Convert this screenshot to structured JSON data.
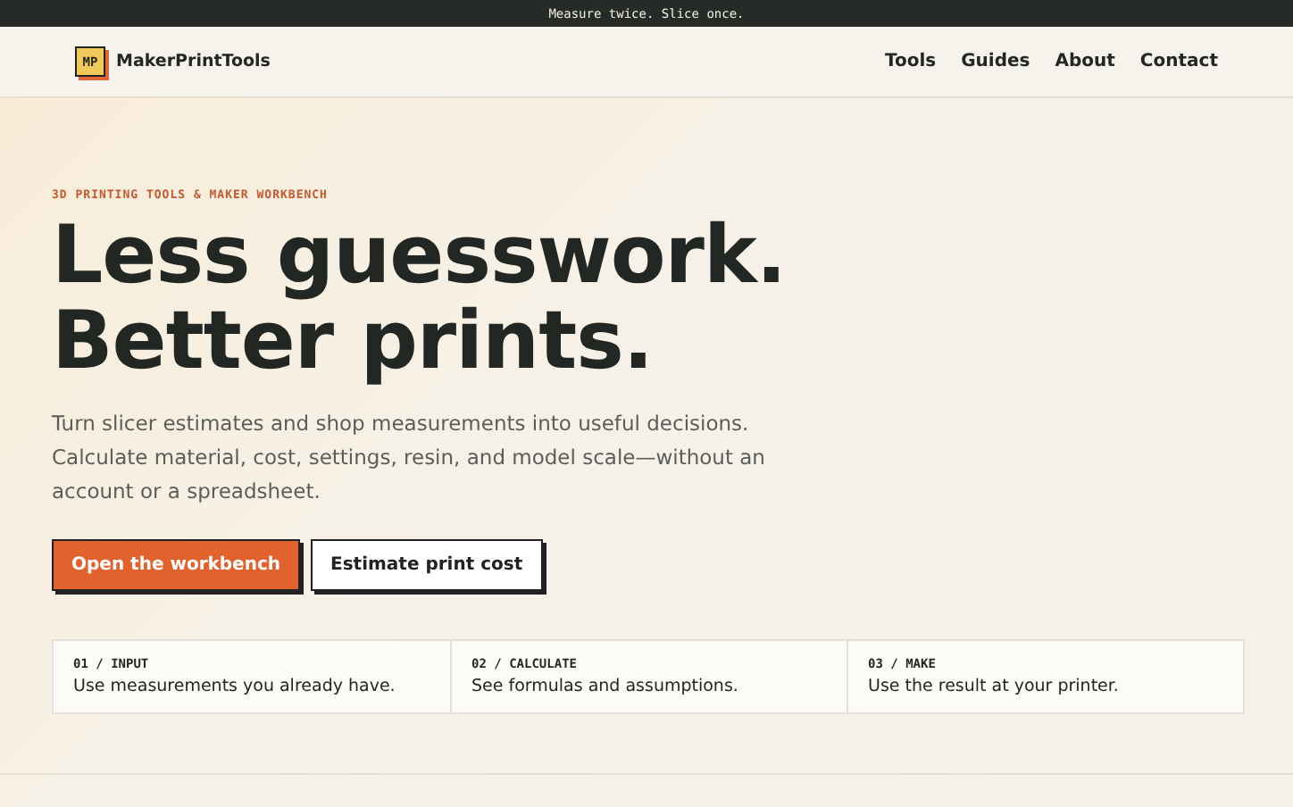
{
  "announcement": "Measure twice. Slice once.",
  "brand": {
    "mark": "MP",
    "name": "MakerPrintTools"
  },
  "nav": [
    "Tools",
    "Guides",
    "About",
    "Contact"
  ],
  "hero": {
    "eyebrow": "3D PRINTING TOOLS & MAKER WORKBENCH",
    "headline": [
      "Less guesswork.",
      "Better prints."
    ],
    "lead": "Turn slicer estimates and shop measurements into useful decisions. Calculate material, cost, settings, resin, and model scale—without an account or a spreadsheet.",
    "buttons": [
      {
        "label": "Open the workbench",
        "kind": "primary"
      },
      {
        "label": "Estimate print cost",
        "kind": "secondary"
      }
    ]
  },
  "steps": [
    {
      "label": "01 / INPUT",
      "text": "Use measurements you already have."
    },
    {
      "label": "02 / CALCULATE",
      "text": "See formulas and assumptions."
    },
    {
      "label": "03 / MAKE",
      "text": "Use the result at your printer."
    }
  ]
}
